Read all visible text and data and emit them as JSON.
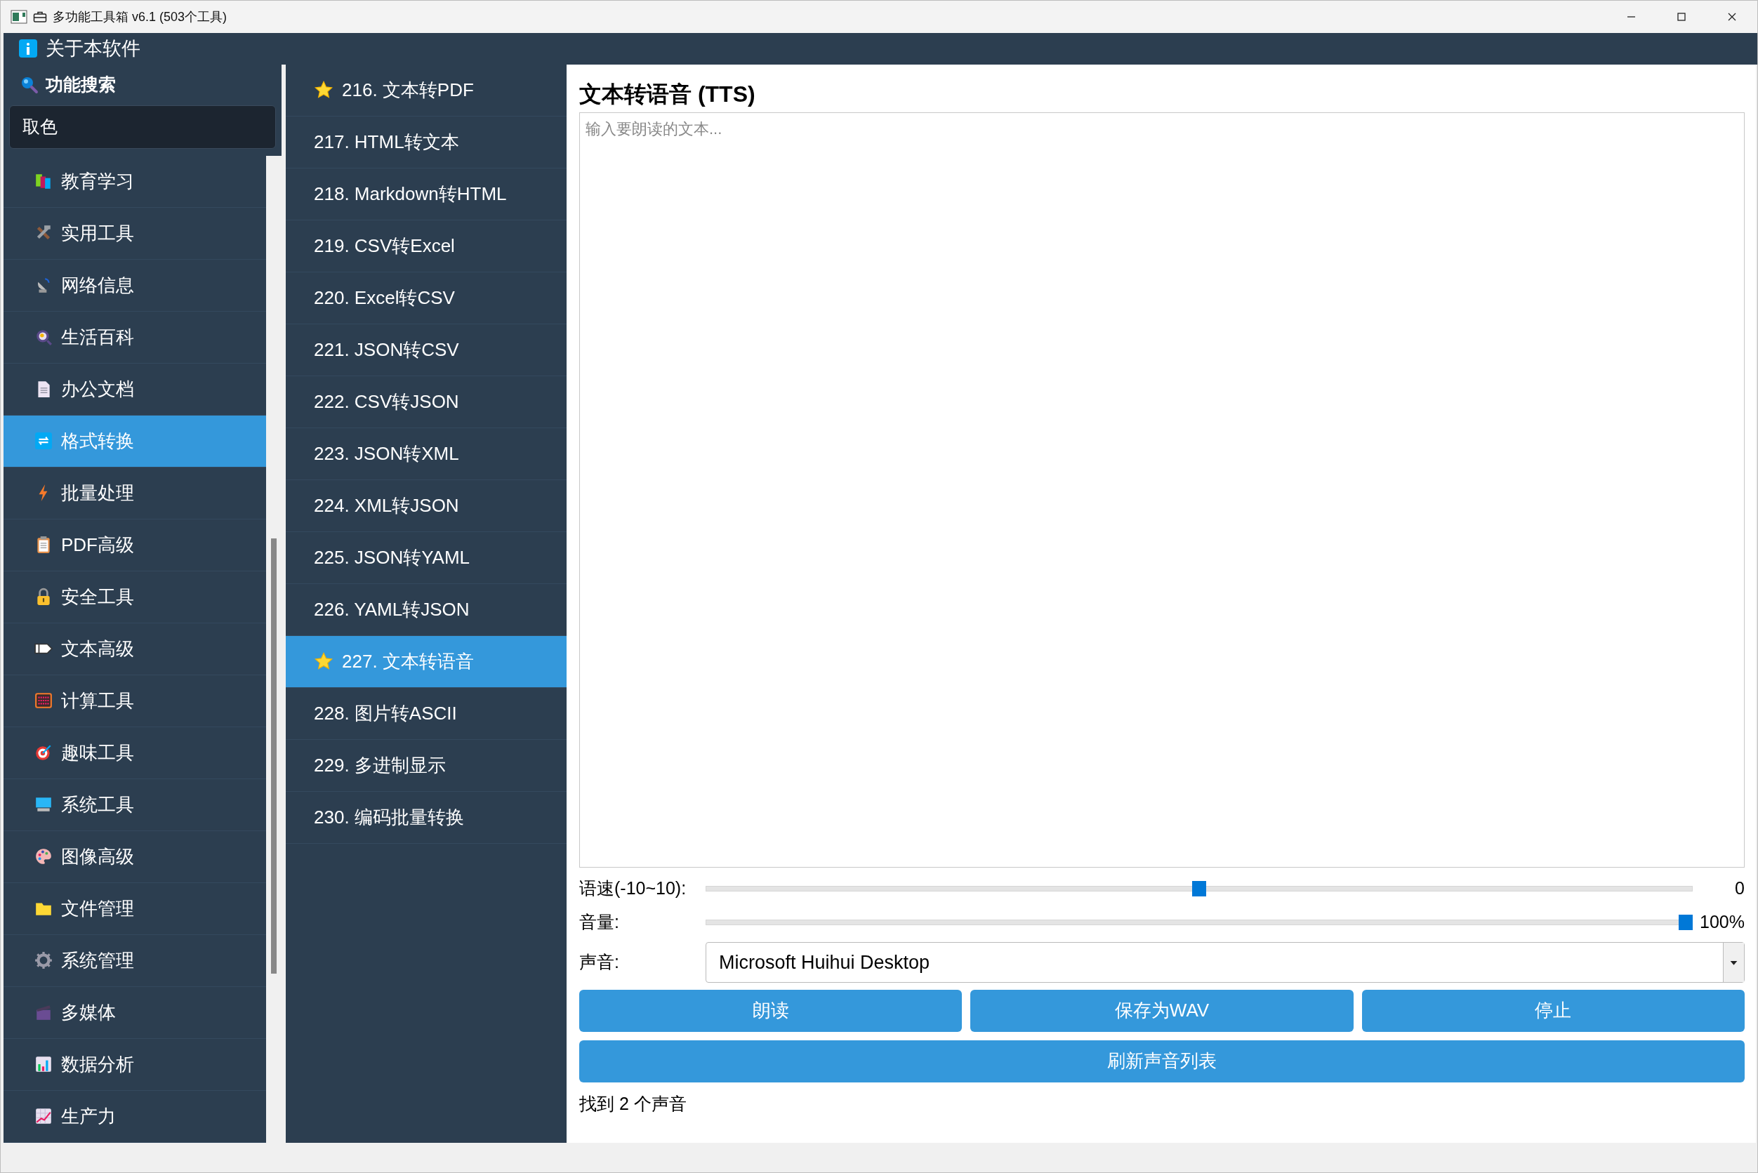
{
  "window": {
    "title": "多功能工具箱 v6.1 (503个工具)"
  },
  "about": {
    "label": "关于本软件"
  },
  "search": {
    "title": "功能搜索",
    "value": "取色"
  },
  "categories": [
    {
      "label": "教育学习",
      "selected": false
    },
    {
      "label": "实用工具",
      "selected": false
    },
    {
      "label": "网络信息",
      "selected": false
    },
    {
      "label": "生活百科",
      "selected": false
    },
    {
      "label": "办公文档",
      "selected": false
    },
    {
      "label": "格式转换",
      "selected": true
    },
    {
      "label": "批量处理",
      "selected": false
    },
    {
      "label": "PDF高级",
      "selected": false
    },
    {
      "label": "安全工具",
      "selected": false
    },
    {
      "label": "文本高级",
      "selected": false
    },
    {
      "label": "计算工具",
      "selected": false
    },
    {
      "label": "趣味工具",
      "selected": false
    },
    {
      "label": "系统工具",
      "selected": false
    },
    {
      "label": "图像高级",
      "selected": false
    },
    {
      "label": "文件管理",
      "selected": false
    },
    {
      "label": "系统管理",
      "selected": false
    },
    {
      "label": "多媒体",
      "selected": false
    },
    {
      "label": "数据分析",
      "selected": false
    },
    {
      "label": "生产力",
      "selected": false
    }
  ],
  "tools": [
    {
      "label": "216. 文本转PDF",
      "starred": true,
      "selected": false
    },
    {
      "label": "217. HTML转文本",
      "starred": false,
      "selected": false
    },
    {
      "label": "218. Markdown转HTML",
      "starred": false,
      "selected": false
    },
    {
      "label": "219. CSV转Excel",
      "starred": false,
      "selected": false
    },
    {
      "label": "220. Excel转CSV",
      "starred": false,
      "selected": false
    },
    {
      "label": "221. JSON转CSV",
      "starred": false,
      "selected": false
    },
    {
      "label": "222. CSV转JSON",
      "starred": false,
      "selected": false
    },
    {
      "label": "223. JSON转XML",
      "starred": false,
      "selected": false
    },
    {
      "label": "224. XML转JSON",
      "starred": false,
      "selected": false
    },
    {
      "label": "225. JSON转YAML",
      "starred": false,
      "selected": false
    },
    {
      "label": "226. YAML转JSON",
      "starred": false,
      "selected": false
    },
    {
      "label": "227. 文本转语音",
      "starred": true,
      "selected": true
    },
    {
      "label": "228. 图片转ASCII",
      "starred": false,
      "selected": false
    },
    {
      "label": "229. 多进制显示",
      "starred": false,
      "selected": false
    },
    {
      "label": "230. 编码批量转换",
      "starred": false,
      "selected": false
    }
  ],
  "panel": {
    "title": "文本转语音 (TTS)",
    "text": {
      "placeholder": "输入要朗读的文本..."
    },
    "speed": {
      "label": "语速(-10~10):",
      "level": 0.5,
      "reading": "0"
    },
    "volume": {
      "label": "音量:",
      "level": 1,
      "reading": "100%"
    },
    "voice": {
      "label": "声音:",
      "value": "Microsoft Huihui Desktop"
    },
    "buttons": [
      "朗读",
      "保存为WAV",
      "停止"
    ],
    "refresh_button": "刷新声音列表",
    "status": "找到 2 个声音"
  }
}
